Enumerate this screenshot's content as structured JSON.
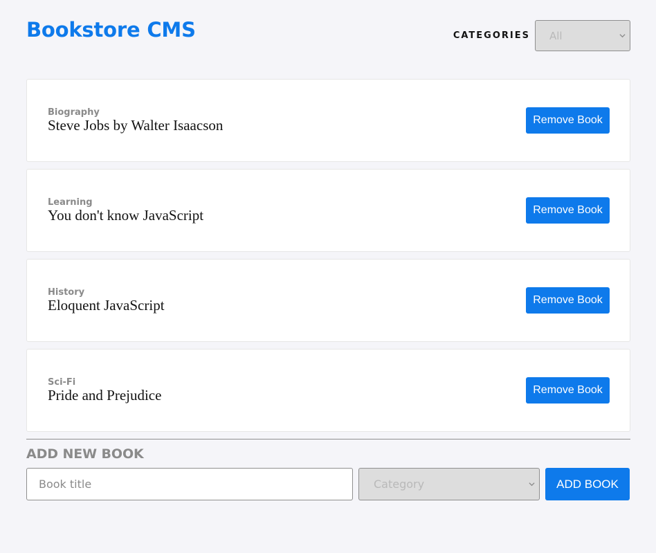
{
  "header": {
    "title": "Bookstore CMS",
    "filter_label": "CATEGORIES",
    "filter_value": "All"
  },
  "books": [
    {
      "category": "Biography",
      "title": "Steve Jobs by Walter Isaacson",
      "remove_label": "Remove Book"
    },
    {
      "category": "Learning",
      "title": "You don't know JavaScript",
      "remove_label": "Remove Book"
    },
    {
      "category": "History",
      "title": "Eloquent JavaScript",
      "remove_label": "Remove Book"
    },
    {
      "category": "Sci-Fi",
      "title": "Pride and Prejudice",
      "remove_label": "Remove Book"
    }
  ],
  "form": {
    "heading": "ADD NEW BOOK",
    "title_placeholder": "Book title",
    "title_value": "",
    "category_placeholder": "Category",
    "submit_label": "ADD BOOK"
  },
  "colors": {
    "accent": "#0e7aeb",
    "background": "#f5f5f9",
    "card": "#ffffff",
    "muted_text": "#8a8a8a"
  },
  "icons": {
    "select_arrow": "chevron-down-icon"
  }
}
